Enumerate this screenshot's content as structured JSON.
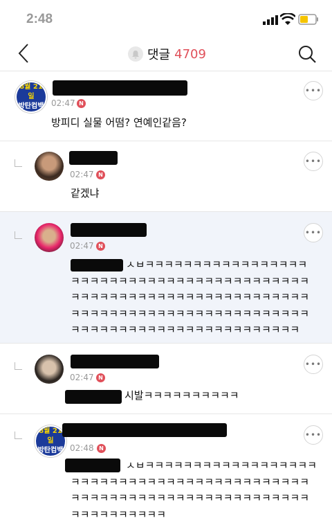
{
  "status_bar": {
    "time": "2:48"
  },
  "header": {
    "title": "댓글",
    "count": "4709"
  },
  "comments": [
    {
      "avatar_line1": "8월 21일",
      "avatar_line2": "방탄컴백",
      "time": "02:47",
      "badge": "N",
      "text": "방피디 실물 어떰? 연예인같음?"
    },
    {
      "time": "02:47",
      "badge": "N",
      "text": "같겠냐"
    },
    {
      "time": "02:47",
      "badge": "N",
      "text": "ㅅㅂㅋㅋㅋㅋㅋㅋㅋㅋㅋㅋㅋㅋㅋㅋㅋㅋㅋ\nㅋㅋㅋㅋㅋㅋㅋㅋㅋㅋㅋㅋㅋㅋㅋㅋㅋㅋㅋㅋㅋㅋㅋㅋㅋ\nㅋㅋㅋㅋㅋㅋㅋㅋㅋㅋㅋㅋㅋㅋㅋㅋㅋㅋㅋㅋㅋㅋㅋㅋㅋ\nㅋㅋㅋㅋㅋㅋㅋㅋㅋㅋㅋㅋㅋㅋㅋㅋㅋㅋㅋㅋㅋㅋㅋㅋㅋ\nㅋㅋㅋㅋㅋㅋㅋㅋㅋㅋㅋㅋㅋㅋㅋㅋㅋㅋㅋㅋㅋㅋㅋㅋ"
    },
    {
      "time": "02:47",
      "badge": "N",
      "text": "시발ㅋㅋㅋㅋㅋㅋㅋㅋㅋㅋ"
    },
    {
      "avatar_line1": "8월 21일",
      "avatar_line2": "방탄컴백",
      "time": "02:48",
      "badge": "N",
      "text": "ㅅㅂㅋㅋㅋㅋㅋㅋㅋㅋㅋㅋㅋㅋㅋㅋㅋㅋㅋㅋ\nㅋㅋㅋㅋㅋㅋㅋㅋㅋㅋㅋㅋㅋㅋㅋㅋㅋㅋㅋㅋㅋㅋㅋㅋㅋ\nㅋㅋㅋㅋㅋㅋㅋㅋㅋㅋㅋㅋㅋㅋㅋㅋㅋㅋㅋㅋㅋㅋㅋㅋㅋ\nㅋㅋㅋㅋㅋㅋㅋㅋㅋㅋ"
    }
  ],
  "icons": {
    "back": "chevron-left-icon",
    "search": "search-icon",
    "bell": "bell-icon",
    "more": "more-options-icon"
  },
  "colors": {
    "accent": "#e0505a",
    "badge_blue": "#1b3a9a",
    "badge_yellow": "#f6d400"
  }
}
